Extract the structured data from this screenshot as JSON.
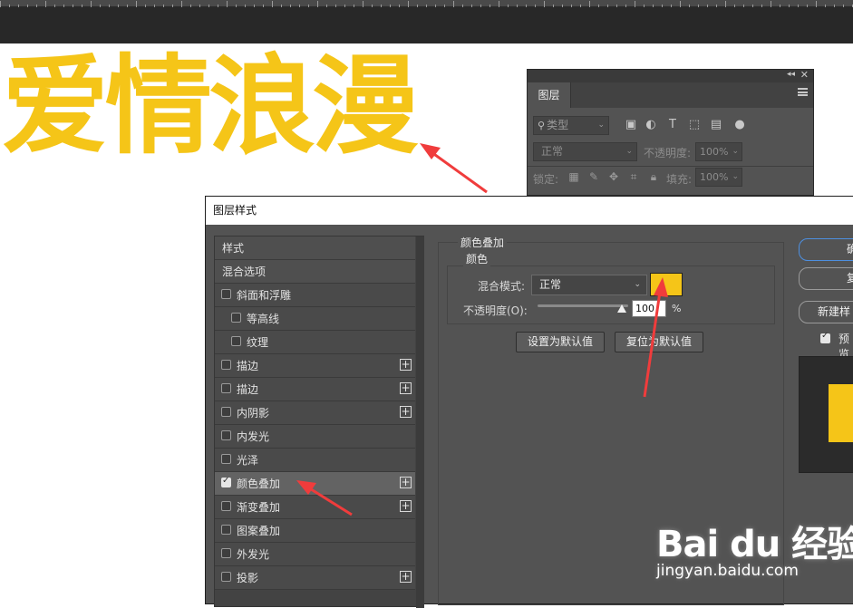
{
  "canvas": {
    "text": "爱情浪漫",
    "text_color": "#f5c518"
  },
  "layers_panel": {
    "tab_label": "图层",
    "filter_placeholder": "类型",
    "blend_mode": "正常",
    "opacity_label": "不透明度:",
    "opacity_value": "100%",
    "lock_label": "锁定:",
    "fill_label": "填充:",
    "fill_value": "100%"
  },
  "dialog": {
    "title": "图层样式",
    "styles": [
      {
        "label": "样式",
        "header": true
      },
      {
        "label": "混合选项",
        "header": true
      },
      {
        "label": "斜面和浮雕",
        "checked": false,
        "indent": false,
        "plus": false
      },
      {
        "label": "等高线",
        "checked": false,
        "indent": true,
        "plus": false
      },
      {
        "label": "纹理",
        "checked": false,
        "indent": true,
        "plus": false
      },
      {
        "label": "描边",
        "checked": false,
        "indent": false,
        "plus": true
      },
      {
        "label": "描边",
        "checked": false,
        "indent": false,
        "plus": true
      },
      {
        "label": "内阴影",
        "checked": false,
        "indent": false,
        "plus": true
      },
      {
        "label": "内发光",
        "checked": false,
        "indent": false,
        "plus": false
      },
      {
        "label": "光泽",
        "checked": false,
        "indent": false,
        "plus": false
      },
      {
        "label": "颜色叠加",
        "checked": true,
        "indent": false,
        "plus": true,
        "selected": true
      },
      {
        "label": "渐变叠加",
        "checked": false,
        "indent": false,
        "plus": true
      },
      {
        "label": "图案叠加",
        "checked": false,
        "indent": false,
        "plus": false
      },
      {
        "label": "外发光",
        "checked": false,
        "indent": false,
        "plus": false
      },
      {
        "label": "投影",
        "checked": false,
        "indent": false,
        "plus": true
      }
    ],
    "color_overlay": {
      "section_title": "颜色叠加",
      "group_title": "颜色",
      "blend_label": "混合模式:",
      "blend_value": "正常",
      "swatch_color": "#f5c518",
      "opacity_label": "不透明度(O):",
      "opacity_value": "100",
      "opacity_unit": "%",
      "opacity_fraction": 1.0,
      "set_default_label": "设置为默认值",
      "reset_default_label": "复位为默认值"
    },
    "right": {
      "ok_label": "确",
      "reset_label": "复",
      "new_style_label": "新建样",
      "preview_label": "预览",
      "preview_checked": true
    }
  },
  "watermark": {
    "logo": "Bai du 经验",
    "url": "jingyan.baidu.com"
  }
}
